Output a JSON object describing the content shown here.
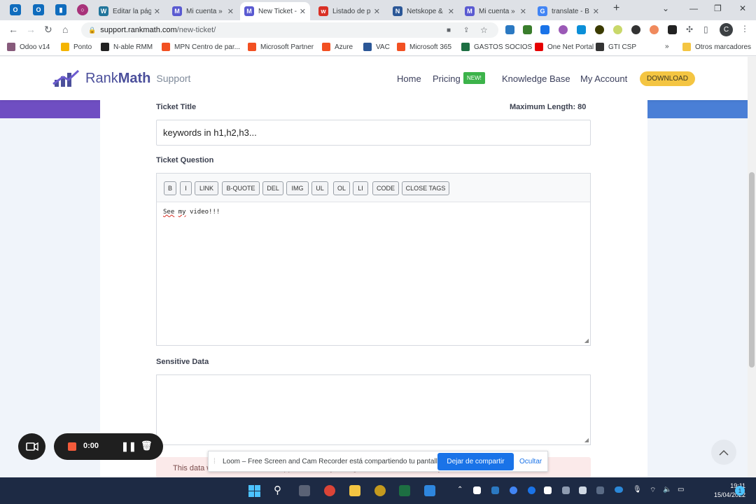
{
  "browser": {
    "tabs": [
      {
        "label": "Editar la pág",
        "color": "#21759b",
        "glyph": "W"
      },
      {
        "label": "Mi cuenta »",
        "color": "#5a5ad1",
        "glyph": "M"
      },
      {
        "label": "New Ticket -",
        "color": "#5a5ad1",
        "glyph": "M",
        "active": true
      },
      {
        "label": "Listado de p",
        "color": "#d93025",
        "glyph": "w"
      },
      {
        "label": "Netskope &",
        "color": "#2b5797",
        "glyph": "N"
      },
      {
        "label": "Mi cuenta »",
        "color": "#5a5ad1",
        "glyph": "M"
      },
      {
        "label": "translate - B",
        "color": "#4285f4",
        "glyph": "G"
      }
    ],
    "url_host": "support.rankmath.com",
    "url_path": "/new-ticket/",
    "profile_initial": "C",
    "bookmarks": [
      {
        "label": "Odoo v14",
        "color": "#875a7b"
      },
      {
        "label": "Ponto",
        "color": "#f4b400"
      },
      {
        "label": "N-able RMM",
        "color": "#222222"
      },
      {
        "label": "MPN Centro de par...",
        "color": "#f25022"
      },
      {
        "label": "Microsoft Partner",
        "color": "#f25022"
      },
      {
        "label": "Azure",
        "color": "#f25022"
      },
      {
        "label": "VAC",
        "color": "#2b5797"
      },
      {
        "label": "Microsoft 365",
        "color": "#f25022"
      },
      {
        "label": "GASTOS SOCIOS",
        "color": "#1d6f42"
      },
      {
        "label": "One Net Portal",
        "color": "#e60000"
      },
      {
        "label": "GTI CSP",
        "color": "#333333"
      }
    ],
    "bookmarks_overflow": "»",
    "other_bookmarks": "Otros marcadores"
  },
  "site": {
    "logo_rank": "Rank",
    "logo_math": "Math",
    "logo_support": "Support",
    "nav": {
      "home": "Home",
      "pricing": "Pricing",
      "new_badge": "NEW!",
      "kb": "Knowledge Base",
      "account": "My Account",
      "download": "DOWNLOAD"
    }
  },
  "form": {
    "title_label": "Ticket Title",
    "max_length": "Maximum Length: 80",
    "title_value": "keywords in h1,h2,h3...",
    "question_label": "Ticket Question",
    "toolbar": [
      "B",
      "I",
      "LINK",
      "B-QUOTE",
      "DEL",
      "IMG",
      "UL",
      "OL",
      "LI",
      "CODE",
      "CLOSE TAGS"
    ],
    "question_words": {
      "w1": "See",
      "w2": "my",
      "w3": "video!!!"
    },
    "sensitive_label": "Sensitive Data",
    "warning": "This data will be visible to our support staff only, and gets deleted automatically once the ticket is resolved."
  },
  "loom": {
    "timer": "0:00",
    "share_text": "Loom – Free Screen and Cam Recorder está compartiendo tu pantalla.",
    "stop_label": "Dejar de compartir",
    "hide_label": "Ocultar"
  },
  "taskbar": {
    "time": "19:11",
    "date": "15/04/2022",
    "notif_count": "1"
  }
}
